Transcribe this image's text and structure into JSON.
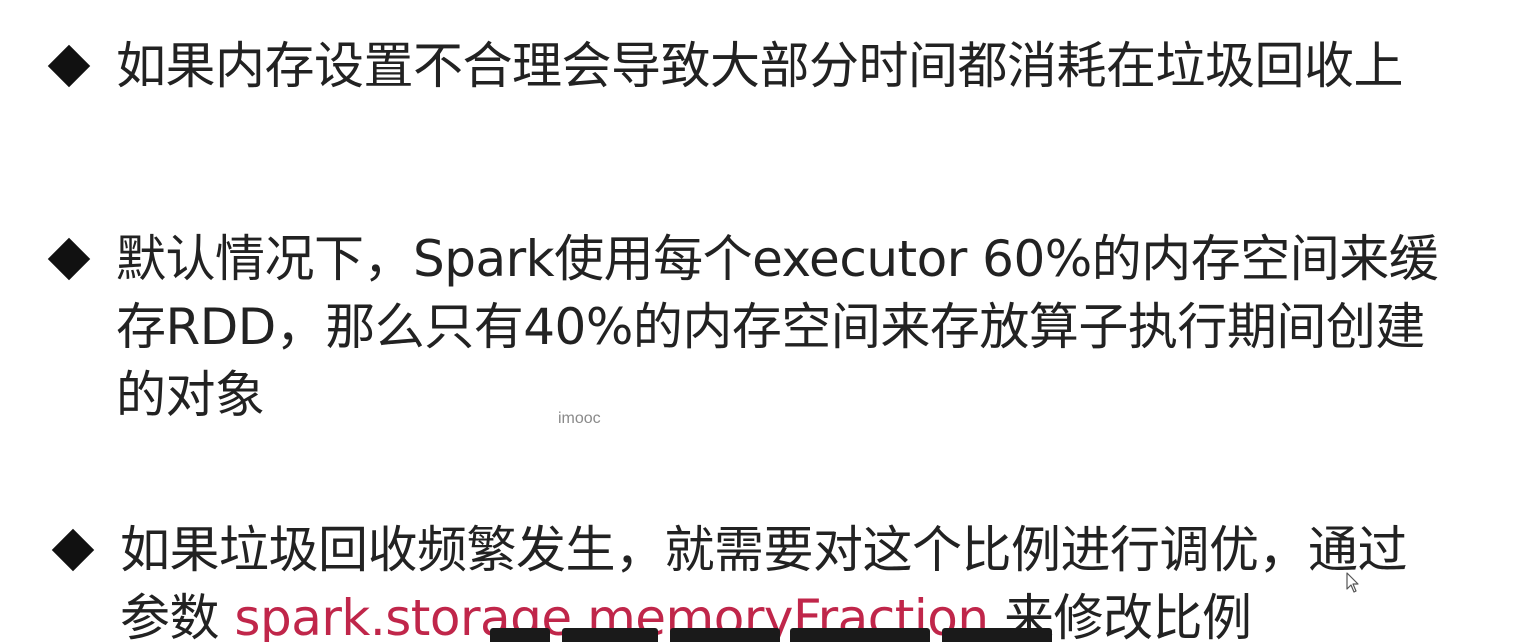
{
  "bullets": [
    {
      "lines": [
        "如果内存设置不合理会导致大部分时间都消耗在垃圾回收上"
      ]
    },
    {
      "lines": [
        "默认情况下，Spark使用每个executor 60%的内存空间来缓",
        "存RDD，那么只有40%的内存空间来存放算子执行期间创建",
        "的对象"
      ]
    },
    {
      "line1": "如果垃圾回收频繁发生，就需要对这个比例进行调优，通过",
      "line2_prefix": "参数 ",
      "line2_param": "spark.storage.memoryFraction",
      "line2_suffix": " 来修改比例"
    }
  ],
  "watermark": "imooc",
  "colors": {
    "text": "#222222",
    "param_highlight": "#c0264a",
    "bullet": "#111111"
  },
  "icons": {
    "bullet": "diamond-bullet-icon",
    "cursor": "mouse-pointer-icon"
  }
}
